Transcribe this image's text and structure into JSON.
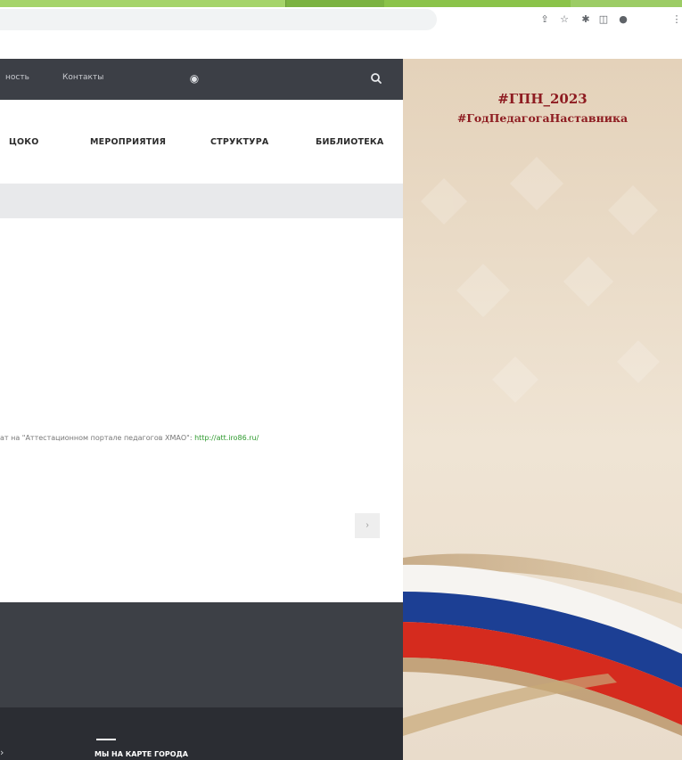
{
  "browser": {
    "icons": [
      "share-icon",
      "star-icon",
      "extensions-icon",
      "sidepanel-icon",
      "profile-icon",
      "menu-icon"
    ]
  },
  "topbar": {
    "link_partial": "ность",
    "contacts": "Контакты"
  },
  "menu": {
    "items": [
      "ЦОКО",
      "МЕРОПРИЯТИЯ",
      "СТРУКТУРА",
      "БИБЛИОТЕКА"
    ]
  },
  "content": {
    "text": "ат на \"Аттестационном портале педагогов ХМАО\": ",
    "link": "http://att.iro86.ru/"
  },
  "pager": {
    "next_label": "›"
  },
  "footer": {
    "map_title": "МЫ НА КАРТЕ ГОРОДА"
  },
  "banner": {
    "hashtag_1": "#ГПН_2023",
    "hashtag_2": "#ГодПедагогаНаставника"
  },
  "colors": {
    "tab_green": "#8bc34a",
    "topbar_dark": "#3c3f46",
    "footer_dark": "#2b2d33",
    "link_green": "#2e9a2e",
    "banner_beige": "#e8d7c0",
    "hashtag_red": "#8e1c21",
    "flag_blue": "#1c3f94",
    "flag_red": "#d52b1e"
  }
}
